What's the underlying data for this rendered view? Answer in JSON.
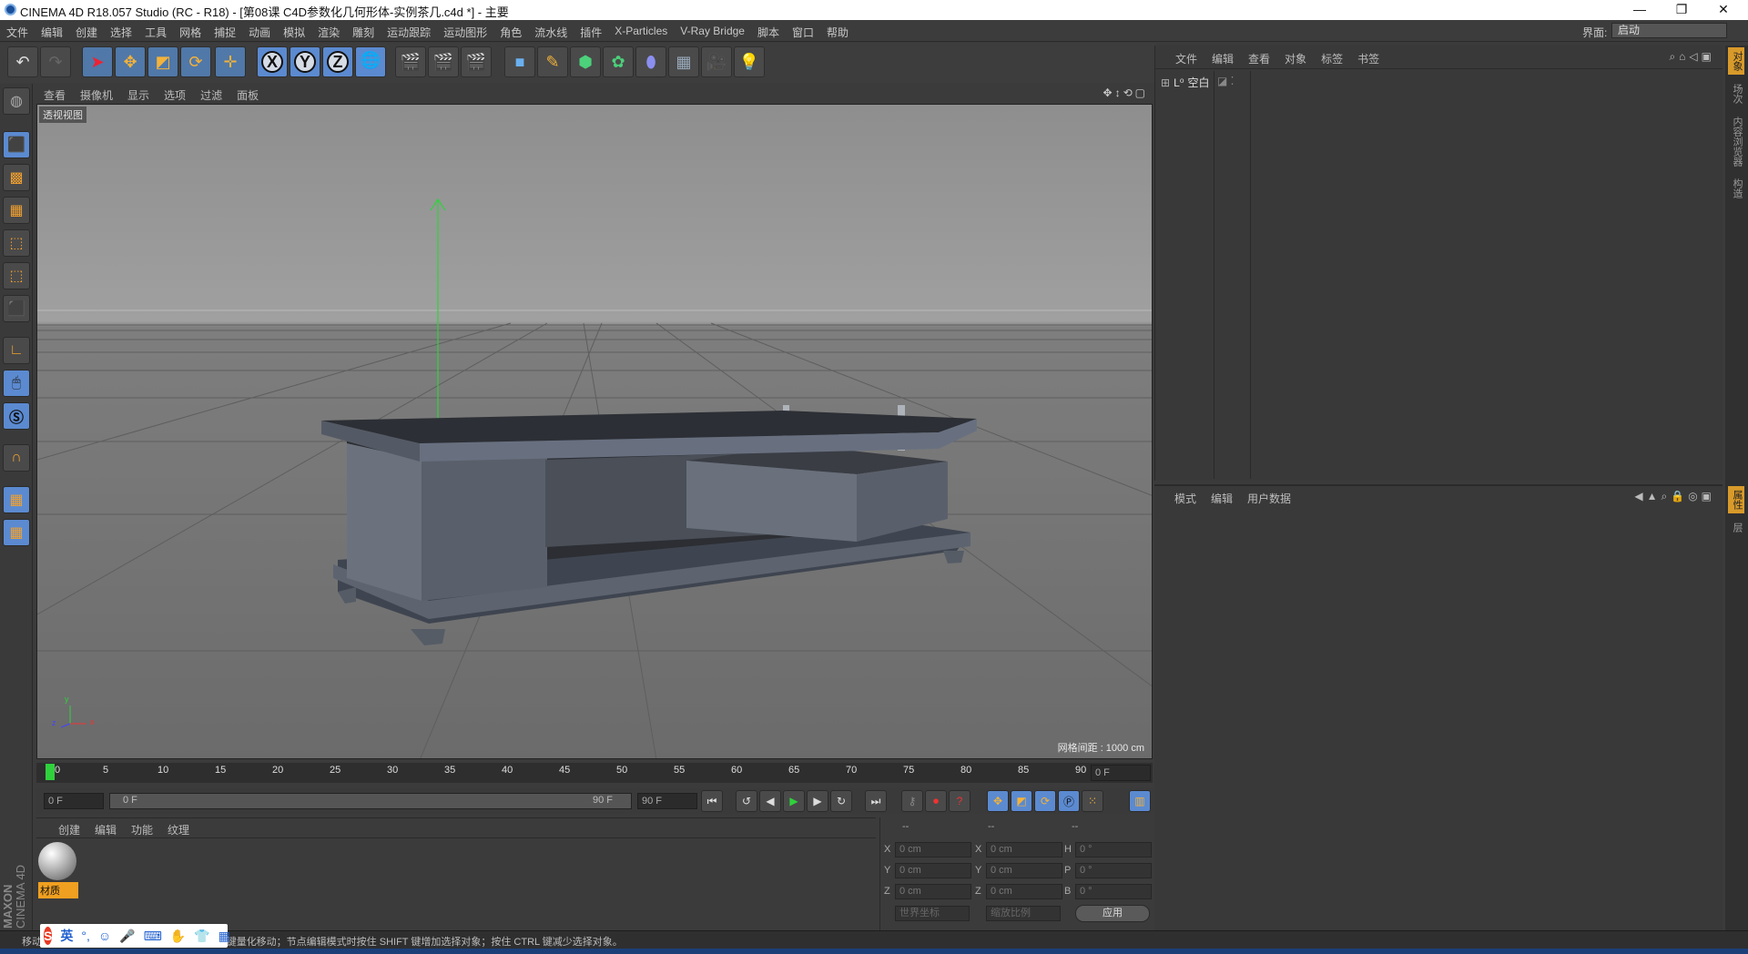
{
  "window": {
    "title": "CINEMA 4D R18.057 Studio (RC - R18) - [第08课   C4D参数化几何形体-实例茶几.c4d *] - 主要",
    "minimize": "—",
    "restore": "❐",
    "close": "✕"
  },
  "menu": {
    "items": [
      "文件",
      "编辑",
      "创建",
      "选择",
      "工具",
      "网格",
      "捕捉",
      "动画",
      "模拟",
      "渲染",
      "雕刻",
      "运动跟踪",
      "运动图形",
      "角色",
      "流水线",
      "插件",
      "X-Particles",
      "V-Ray Bridge",
      "脚本",
      "窗口",
      "帮助"
    ],
    "interface_label": "界面:",
    "interface_value": "启动"
  },
  "viewport": {
    "menu": [
      "查看",
      "摄像机",
      "显示",
      "选项",
      "过滤",
      "面板"
    ],
    "label": "透视视图",
    "grid_info": "网格间距 : 1000 cm",
    "axis_x": "x",
    "axis_y": "y",
    "axis_z": "z"
  },
  "timeline": {
    "ticks": [
      "0",
      "5",
      "10",
      "15",
      "20",
      "25",
      "30",
      "35",
      "40",
      "45",
      "50",
      "55",
      "60",
      "65",
      "70",
      "75",
      "80",
      "85",
      "90"
    ],
    "current_frame": "0 F",
    "start_field": "0 F",
    "range_start": "0 F",
    "range_end": "90 F",
    "end_field": "90 F"
  },
  "materials": {
    "menu": [
      "创建",
      "编辑",
      "功能",
      "纹理"
    ],
    "item_label": "材质"
  },
  "coords": {
    "headers": [
      "--",
      "--",
      "--"
    ],
    "rows": [
      {
        "l1": "X",
        "v1": "0 cm",
        "l2": "X",
        "v2": "0 cm",
        "l3": "H",
        "v3": "0 °"
      },
      {
        "l1": "Y",
        "v1": "0 cm",
        "l2": "Y",
        "v2": "0 cm",
        "l3": "P",
        "v3": "0 °"
      },
      {
        "l1": "Z",
        "v1": "0 cm",
        "l2": "Z",
        "v2": "0 cm",
        "l3": "B",
        "v3": "0 °"
      }
    ],
    "world": "世界坐标",
    "scale": "缩放比例",
    "apply": "应用"
  },
  "objects": {
    "menu": [
      "文件",
      "编辑",
      "查看",
      "对象",
      "标签",
      "书签"
    ],
    "item": "空白"
  },
  "attributes": {
    "menu": [
      "模式",
      "编辑",
      "用户数据"
    ]
  },
  "right_tabs": [
    "对象",
    "场次",
    "内容浏览器",
    "构造"
  ],
  "right_tabs2": [
    "属性",
    "层"
  ],
  "status": {
    "text": "移动：点击并拖动鼠标移动元素。按住 SHIFT 键量化移动；节点编辑模式时按住 SHIFT 键增加选择对象；按住 CTRL 键减少选择对象。"
  },
  "brand": {
    "maxon": "MAXON",
    "c4d": "CINEMA 4D"
  },
  "ime": {
    "lang": "英"
  }
}
